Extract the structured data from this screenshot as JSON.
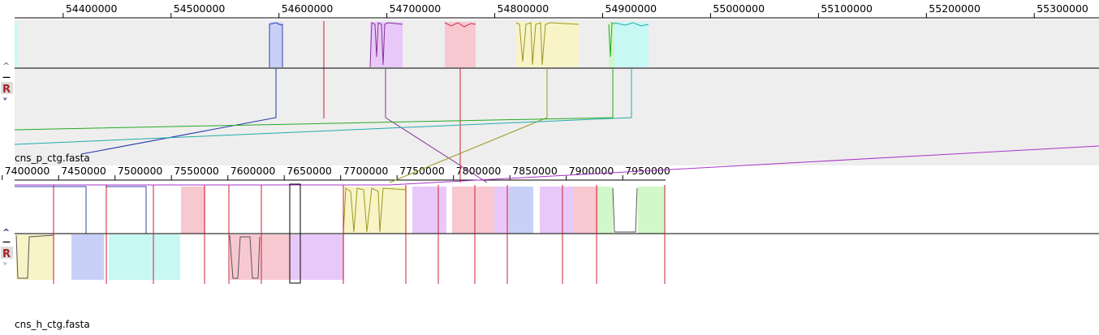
{
  "top_panel": {
    "label": "cns_p_ctg.fasta",
    "ruler_ticks": [
      "54400000",
      "54500000",
      "54600000",
      "54700000",
      "54800000",
      "54900000",
      "55000000",
      "55100000",
      "55200000",
      "55300000"
    ],
    "ruler_range": [
      54355000,
      55360000
    ],
    "controls": {
      "up": "^",
      "minus": "—",
      "r": "R",
      "down": "˅"
    }
  },
  "bottom_panel": {
    "label": "cns_h_ctg.fasta",
    "ruler_ticks": [
      "7400000",
      "7450000",
      "7500000",
      "7550000",
      "7600000",
      "7650000",
      "7700000",
      "7750000",
      "7800000",
      "7850000",
      "7900000",
      "7950000"
    ],
    "ruler_range": [
      7411000,
      7988000
    ],
    "controls": {
      "up": "^",
      "minus": "—",
      "r": "R",
      "down": "˅"
    }
  },
  "colors": {
    "panel_bg": "#eeeeee",
    "blue": "#c8d0f8",
    "purple": "#e8c8f8",
    "pink": "#f8c8d0",
    "yellow": "#f8f4c8",
    "cyan": "#c8f8f4",
    "green": "#d0f8c8",
    "lcb_line": "#cc2233"
  }
}
